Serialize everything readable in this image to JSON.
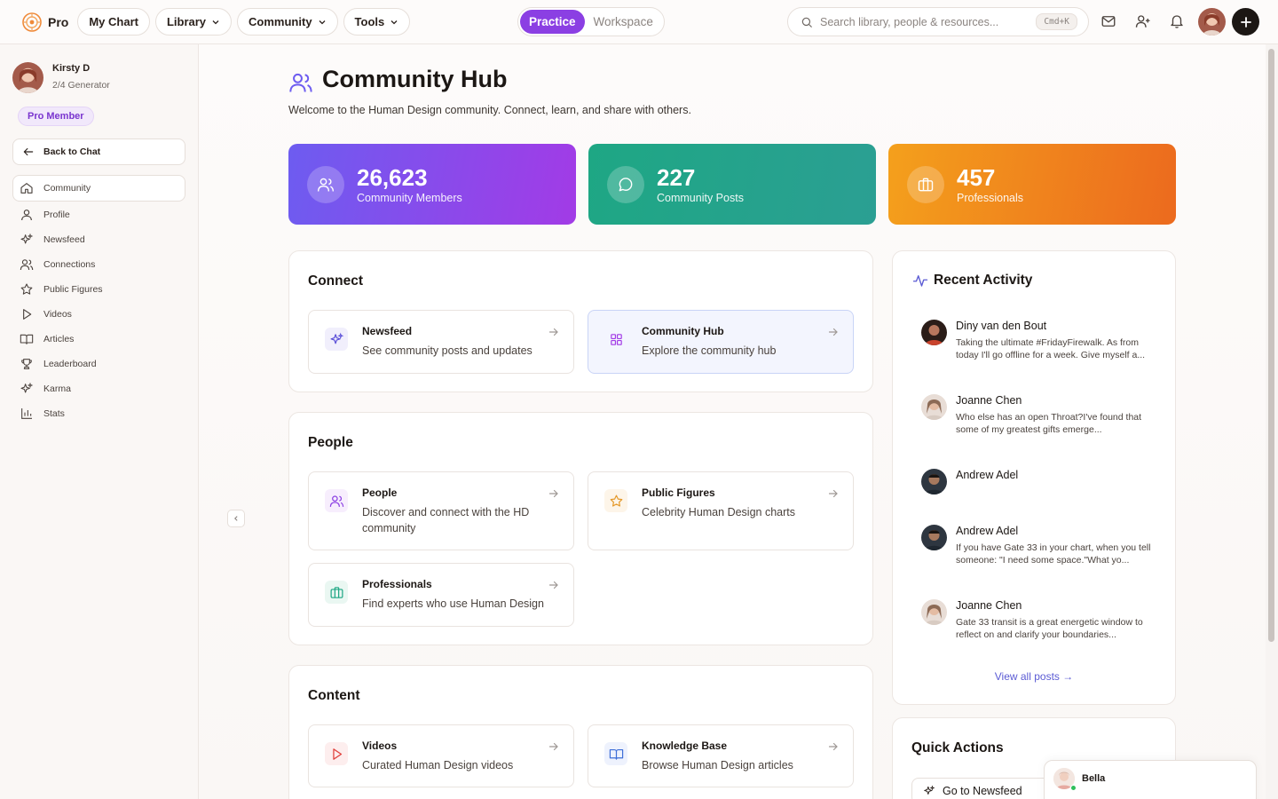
{
  "topbar": {
    "logo_text": "Pro",
    "nav": [
      {
        "label": "My Chart",
        "dropdown": false
      },
      {
        "label": "Library",
        "dropdown": true
      },
      {
        "label": "Community",
        "dropdown": true
      },
      {
        "label": "Tools",
        "dropdown": true
      }
    ],
    "modes": [
      "Practice",
      "Workspace"
    ],
    "active_mode": "Practice",
    "search_placeholder": "Search library, people & resources...",
    "search_shortcut": "Cmd+K"
  },
  "sidebar": {
    "user_name": "Kirsty D",
    "user_type": "2/4 Generator",
    "badge": "Pro Member",
    "back_label": "Back to Chat",
    "items": [
      {
        "label": "Community",
        "icon": "home-icon",
        "active": true
      },
      {
        "label": "Profile",
        "icon": "user-icon"
      },
      {
        "label": "Newsfeed",
        "icon": "sparkles-icon"
      },
      {
        "label": "Connections",
        "icon": "users-icon"
      },
      {
        "label": "Public Figures",
        "icon": "star-icon"
      },
      {
        "label": "Videos",
        "icon": "play-icon"
      },
      {
        "label": "Articles",
        "icon": "book-icon"
      },
      {
        "label": "Leaderboard",
        "icon": "trophy-icon"
      },
      {
        "label": "Karma",
        "icon": "sparkles-icon"
      },
      {
        "label": "Stats",
        "icon": "bar-chart-icon"
      }
    ]
  },
  "page": {
    "title": "Community Hub",
    "subtitle": "Welcome to the Human Design community. Connect, learn, and share with others."
  },
  "stats": [
    {
      "value": "26,623",
      "label": "Community Members",
      "icon": "users-icon",
      "color_from": "#6d5cf0",
      "color_to": "#a23be6"
    },
    {
      "value": "227",
      "label": "Community Posts",
      "icon": "message-circle-icon",
      "color_from": "#1ea784",
      "color_to": "#2b9f93"
    },
    {
      "value": "457",
      "label": "Professionals",
      "icon": "briefcase-icon",
      "color_from": "#f4a01c",
      "color_to": "#ec6a1e"
    }
  ],
  "sections": {
    "connect": {
      "title": "Connect",
      "cards": [
        {
          "title": "Newsfeed",
          "desc": "See community posts and updates",
          "icon": "sparkles-icon"
        },
        {
          "title": "Community Hub",
          "desc": "Explore the community hub",
          "icon": "grid-icon"
        }
      ]
    },
    "people": {
      "title": "People",
      "cards": [
        {
          "title": "People",
          "desc": "Discover and connect with the HD community",
          "icon": "users-icon"
        },
        {
          "title": "Public Figures",
          "desc": "Celebrity Human Design charts",
          "icon": "star-icon"
        },
        {
          "title": "Professionals",
          "desc": "Find experts who use Human Design",
          "icon": "briefcase-icon"
        }
      ]
    },
    "content": {
      "title": "Content",
      "cards": [
        {
          "title": "Videos",
          "desc": "Curated Human Design videos",
          "icon": "play-icon"
        },
        {
          "title": "Knowledge Base",
          "desc": "Browse Human Design articles",
          "icon": "book-icon"
        }
      ]
    }
  },
  "activity": {
    "title": "Recent Activity",
    "items": [
      {
        "name": "Diny van den Bout",
        "text": "Taking the ultimate #FridayFirewalk. As from today I'll go offline for a week. Give myself a..."
      },
      {
        "name": "Joanne Chen",
        "text": "Who else has an open Throat?I've found that some of my greatest gifts emerge..."
      },
      {
        "name": "Andrew Adel",
        "text": ""
      },
      {
        "name": "Andrew Adel",
        "text": "If you have Gate 33 in your chart, when you tell someone: \"I need some space.\"What yo..."
      },
      {
        "name": "Joanne Chen",
        "text": "Gate 33 transit is a great energetic window to reflect on and clarify your boundaries..."
      }
    ],
    "view_all": "View all posts →"
  },
  "quick_actions": {
    "title": "Quick Actions",
    "first_button": "Go to Newsfeed"
  },
  "chat": {
    "name": "Bella"
  },
  "colors": {
    "accent": "#8b3fe3",
    "link": "#5b5bd4"
  }
}
